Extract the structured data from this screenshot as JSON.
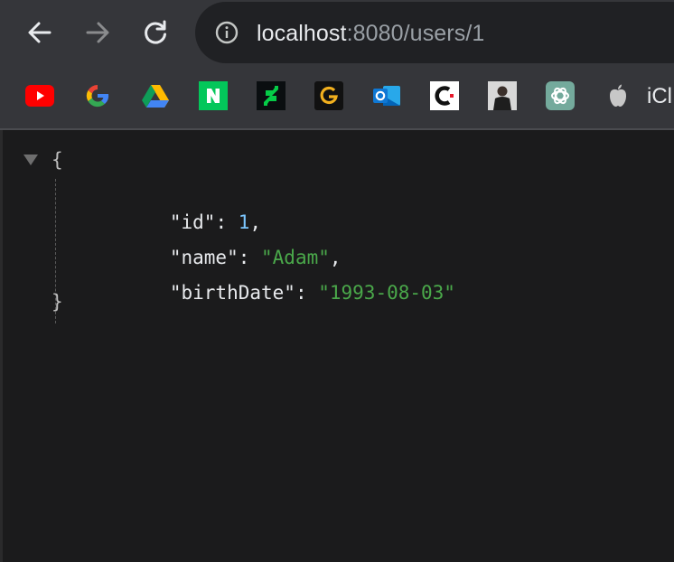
{
  "browser": {
    "url_host": "localhost",
    "url_rest": ":8080/users/1"
  },
  "bookmarks": {
    "items": [
      {
        "name": "youtube-bookmark",
        "icon": "youtube-icon"
      },
      {
        "name": "google-bookmark",
        "icon": "google-icon"
      },
      {
        "name": "google-drive-bookmark",
        "icon": "google-drive-icon"
      },
      {
        "name": "naver-bookmark",
        "icon": "naver-n-icon"
      },
      {
        "name": "deviantart-bookmark",
        "icon": "deviantart-icon"
      },
      {
        "name": "g-bookmark",
        "icon": "g-logo-icon"
      },
      {
        "name": "outlook-bookmark",
        "icon": "outlook-icon"
      },
      {
        "name": "c-bookmark",
        "icon": "c-logo-icon"
      },
      {
        "name": "profile-bookmark",
        "icon": "person-photo-icon"
      },
      {
        "name": "chatgpt-bookmark",
        "icon": "openai-icon"
      },
      {
        "name": "icloud-bookmark",
        "icon": "apple-icon"
      }
    ],
    "icloud_label": "iCl"
  },
  "json": {
    "open_brace": "{",
    "close_brace": "}",
    "lines": [
      {
        "key": "\"id\"",
        "sep": ": ",
        "value": "1",
        "type": "number",
        "trail": ","
      },
      {
        "key": "\"name\"",
        "sep": ": ",
        "value": "\"Adam\"",
        "type": "string",
        "trail": ","
      },
      {
        "key": "\"birthDate\"",
        "sep": ": ",
        "value": "\"1993-08-03\"",
        "type": "string",
        "trail": ""
      }
    ]
  },
  "colors": {
    "toolbar": "#35363a",
    "omnibox": "#202124",
    "page_bg": "#1b1b1c",
    "json_number": "#7cc7ff",
    "json_string": "#4aa84a"
  }
}
